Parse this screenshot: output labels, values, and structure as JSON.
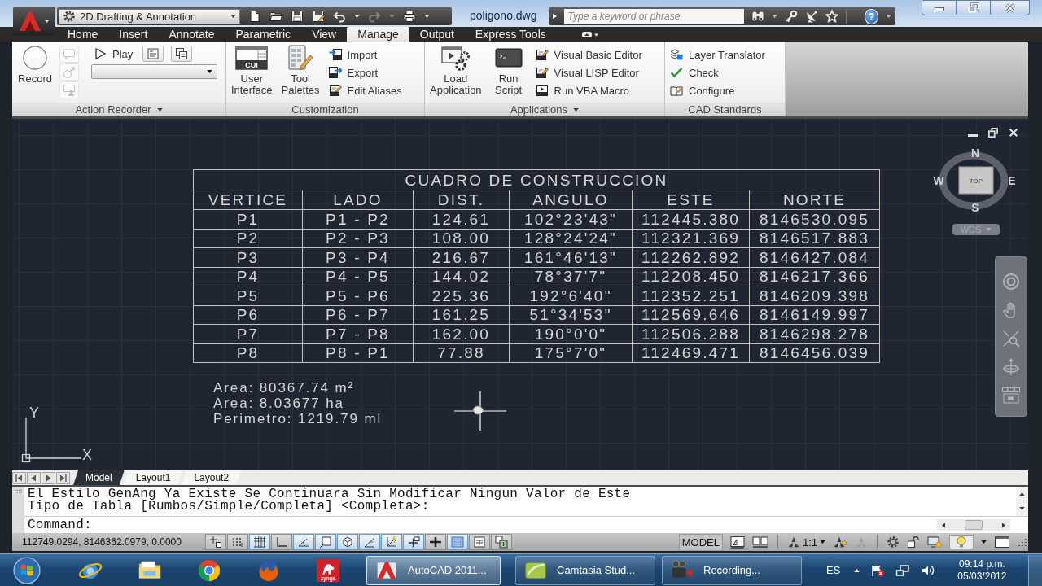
{
  "title_bar": {
    "workspace": "2D Drafting & Annotation",
    "document": "poligono.dwg",
    "search": {
      "placeholder": "Type a keyword or phrase"
    },
    "help_glyph": "?"
  },
  "quick_access": [
    {
      "disabled": false
    },
    {
      "disabled": false
    },
    {
      "disabled": false
    },
    {
      "disabled": false
    },
    {
      "disabled": false
    },
    {
      "disabled": true
    },
    {
      "disabled": false
    }
  ],
  "ribbon_tabs": [
    {
      "label": "Home",
      "selected": false
    },
    {
      "label": "Insert",
      "selected": false
    },
    {
      "label": "Annotate",
      "selected": false
    },
    {
      "label": "Parametric",
      "selected": false
    },
    {
      "label": "View",
      "selected": false
    },
    {
      "label": "Manage",
      "selected": true
    },
    {
      "label": "Output",
      "selected": false
    },
    {
      "label": "Express Tools",
      "selected": false
    }
  ],
  "ribbon_panels": [
    {
      "title": "Action Recorder",
      "has_menu": true,
      "columns": [
        [
          {
            "kind": "large",
            "label": "Record"
          }
        ],
        [
          {
            "kind": "icon",
            "disabled": true
          },
          {
            "kind": "icon",
            "disabled": true
          },
          {
            "kind": "icon",
            "disabled": true
          }
        ],
        [
          {
            "kind": "playbar",
            "label": "Play"
          },
          {
            "kind": "dropdown"
          }
        ]
      ]
    },
    {
      "title": "Customization",
      "has_menu": false,
      "columns": [
        [
          {
            "kind": "large",
            "label": "User Interface",
            "icon_text": "CUI"
          }
        ],
        [
          {
            "kind": "large",
            "label": "Tool Palettes"
          }
        ],
        [
          {
            "kind": "small",
            "label": "Import"
          },
          {
            "kind": "small",
            "label": "Export"
          },
          {
            "kind": "small",
            "label": "Edit Aliases"
          }
        ]
      ]
    },
    {
      "title": "Applications",
      "has_menu": true,
      "columns": [
        [
          {
            "kind": "large",
            "label": "Load Application"
          }
        ],
        [
          {
            "kind": "large",
            "label": "Run Script"
          }
        ],
        [
          {
            "kind": "small",
            "label": "Visual Basic Editor"
          },
          {
            "kind": "small",
            "label": "Visual LISP Editor"
          },
          {
            "kind": "small",
            "label": "Run VBA Macro"
          }
        ]
      ]
    },
    {
      "title": "CAD Standards",
      "has_menu": false,
      "columns": [
        [
          {
            "kind": "small",
            "label": "Layer Translator"
          },
          {
            "kind": "small",
            "label": "Check"
          },
          {
            "kind": "small",
            "label": "Configure"
          }
        ]
      ]
    }
  ],
  "drawing": {
    "table": {
      "title": "CUADRO DE CONSTRUCCION",
      "columns": [
        "VERTICE",
        "LADO",
        "DIST.",
        "ANGULO",
        "ESTE",
        "NORTE"
      ],
      "rows": [
        [
          "P1",
          "P1 - P2",
          "124.61",
          "102°23'43\"",
          "112445.380",
          "8146530.095"
        ],
        [
          "P2",
          "P2 - P3",
          "108.00",
          "128°24'24\"",
          "112321.369",
          "8146517.883"
        ],
        [
          "P3",
          "P3 - P4",
          "216.67",
          "161°46'13\"",
          "112262.892",
          "8146427.084"
        ],
        [
          "P4",
          "P4 - P5",
          "144.02",
          "78°37'7\"",
          "112208.450",
          "8146217.366"
        ],
        [
          "P5",
          "P5 - P6",
          "225.36",
          "192°6'40\"",
          "112352.251",
          "8146209.398"
        ],
        [
          "P6",
          "P6 - P7",
          "161.25",
          "51°34'53\"",
          "112569.646",
          "8146149.997"
        ],
        [
          "P7",
          "P7 - P8",
          "162.00",
          "190°0'0\"",
          "112506.288",
          "8146298.278"
        ],
        [
          "P8",
          "P8 - P1",
          "77.88",
          "175°7'0\"",
          "112469.471",
          "8146456.039"
        ]
      ]
    },
    "notes": [
      "Area: 80367.74 m²",
      "Area: 8.03677 ha",
      "Perimetro: 1219.79 ml"
    ],
    "ucs_icon": {
      "x_label": "X",
      "y_label": "Y"
    },
    "viewcube": {
      "face": "TOP",
      "north": "N",
      "south": "S",
      "east": "E",
      "west": "W",
      "ucs_menu": "WCS"
    }
  },
  "layout_tabs": [
    {
      "label": "Model",
      "selected": true
    },
    {
      "label": "Layout1",
      "selected": false
    },
    {
      "label": "Layout2",
      "selected": false
    }
  ],
  "command_window": {
    "history": [
      "El Estilo GenAng Ya Existe Se Continuara Sin Modificar Ningun Valor de Este",
      "Tipo de Tabla [Rumbos/Simple/Completa] <Completa>:"
    ],
    "prompt": "Command:"
  },
  "status_bar": {
    "coordinates": "112749.0294, 8146362.0979, 0.0000",
    "toggles": [
      {
        "on": false
      },
      {
        "on": false
      },
      {
        "on": true
      },
      {
        "on": false
      },
      {
        "on": true
      },
      {
        "on": true
      },
      {
        "on": true
      },
      {
        "on": true
      },
      {
        "on": true
      },
      {
        "on": true
      },
      {
        "on": false
      },
      {
        "on": true
      },
      {
        "on": false
      },
      {
        "on": false
      }
    ],
    "space": "MODEL",
    "annotation_scale": "1:1"
  },
  "taskbar": {
    "pinned_logo_text": "zynga",
    "tasks": [
      {
        "label": "AutoCAD 2011...",
        "selected": true
      },
      {
        "label": "Camtasia Stud...",
        "selected": false
      },
      {
        "label": "Recording...",
        "selected": false
      }
    ],
    "language": "ES",
    "time": "09:14 p.m.",
    "date": "05/03/2012"
  }
}
